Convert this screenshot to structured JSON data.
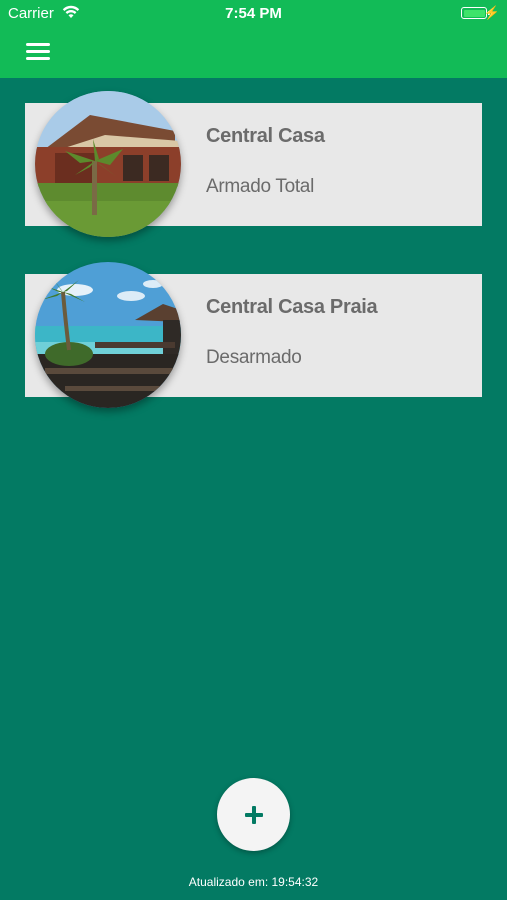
{
  "status_bar": {
    "carrier": "Carrier",
    "time": "7:54 PM",
    "battery_level": 1.0
  },
  "nav": {
    "menu_icon": "hamburger-menu-icon",
    "bar_color": "#12bb57"
  },
  "centrals": [
    {
      "name": "Central Casa",
      "status": "Armado Total",
      "image": "house-photo"
    },
    {
      "name": "Central Casa Praia",
      "status": "Desarmado",
      "image": "beach-photo"
    }
  ],
  "fab": {
    "icon": "plus-icon"
  },
  "footer": {
    "updated": "Atualizado em: 19:54:32"
  },
  "colors": {
    "background": "#037a63",
    "accent": "#12bb57",
    "card": "#e8e8e8",
    "text": "#6b6b6b"
  }
}
